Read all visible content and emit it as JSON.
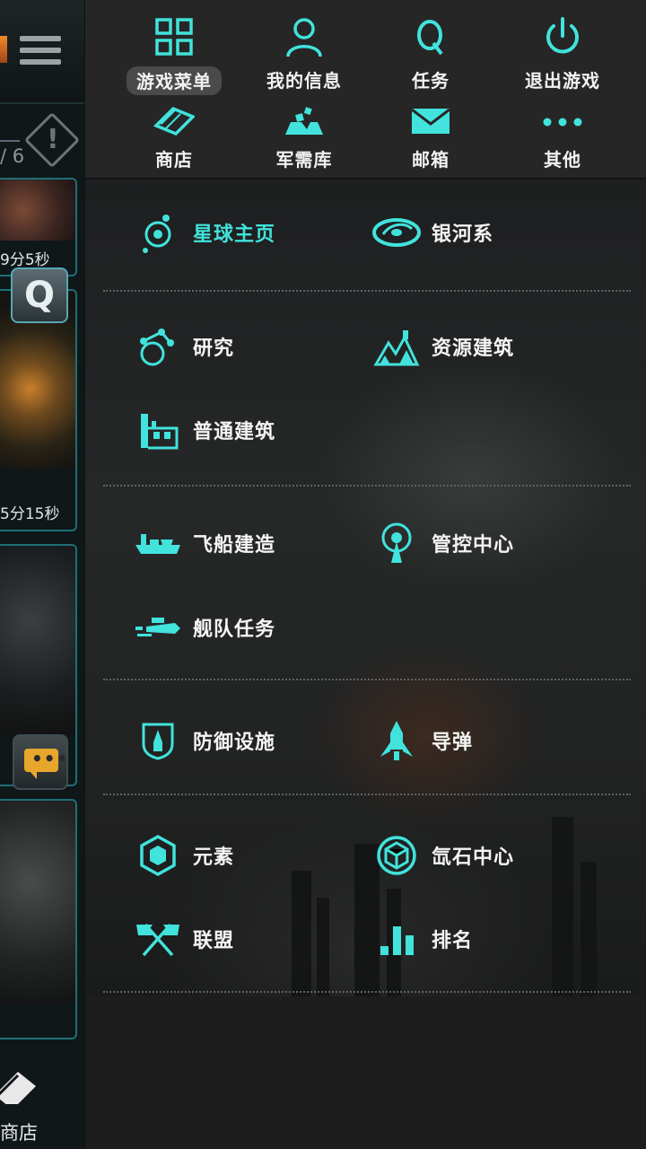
{
  "colors": {
    "accent": "#41e3dc",
    "panel_bg": "#1d1d1d",
    "topbar_bg": "#262626",
    "text": "#f4f4f4"
  },
  "background_screen": {
    "counter": "/ 6",
    "timer_1": "9分5秒",
    "timer_2": "5分15秒",
    "q_button": "Q",
    "shop_label": "商店",
    "chat_dots": "•••"
  },
  "top_menu": [
    {
      "label": "游戏菜单",
      "icon": "grid-icon",
      "active": true
    },
    {
      "label": "我的信息",
      "icon": "user-icon"
    },
    {
      "label": "任务",
      "icon": "quest-q-icon"
    },
    {
      "label": "退出游戏",
      "icon": "power-icon"
    },
    {
      "label": "商店",
      "icon": "ticket-icon"
    },
    {
      "label": "军需库",
      "icon": "depot-icon"
    },
    {
      "label": "邮箱",
      "icon": "mail-icon"
    },
    {
      "label": "其他",
      "icon": "more-dots-icon"
    }
  ],
  "menu_sections": {
    "planet_home": {
      "label": "星球主页",
      "icon": "planet-orbit-icon",
      "active": true
    },
    "galaxy": {
      "label": "银河系",
      "icon": "galaxy-icon"
    },
    "research": {
      "label": "研究",
      "icon": "research-icon"
    },
    "resource_buildings": {
      "label": "资源建筑",
      "icon": "mining-icon"
    },
    "normal_buildings": {
      "label": "普通建筑",
      "icon": "factory-icon"
    },
    "ship_building": {
      "label": "飞船建造",
      "icon": "carrier-ship-icon"
    },
    "control_center": {
      "label": "管控中心",
      "icon": "antenna-icon"
    },
    "fleet_missions": {
      "label": "舰队任务",
      "icon": "fleet-icon"
    },
    "defense": {
      "label": "防御设施",
      "icon": "shield-rocket-icon"
    },
    "missile": {
      "label": "导弹",
      "icon": "missile-icon"
    },
    "elements": {
      "label": "元素",
      "icon": "hexagon-element-icon"
    },
    "krypton_center": {
      "label": "氙石中心",
      "icon": "crystal-core-icon"
    },
    "alliance": {
      "label": "联盟",
      "icon": "crossed-flags-icon"
    },
    "ranking": {
      "label": "排名",
      "icon": "bar-chart-icon"
    }
  }
}
